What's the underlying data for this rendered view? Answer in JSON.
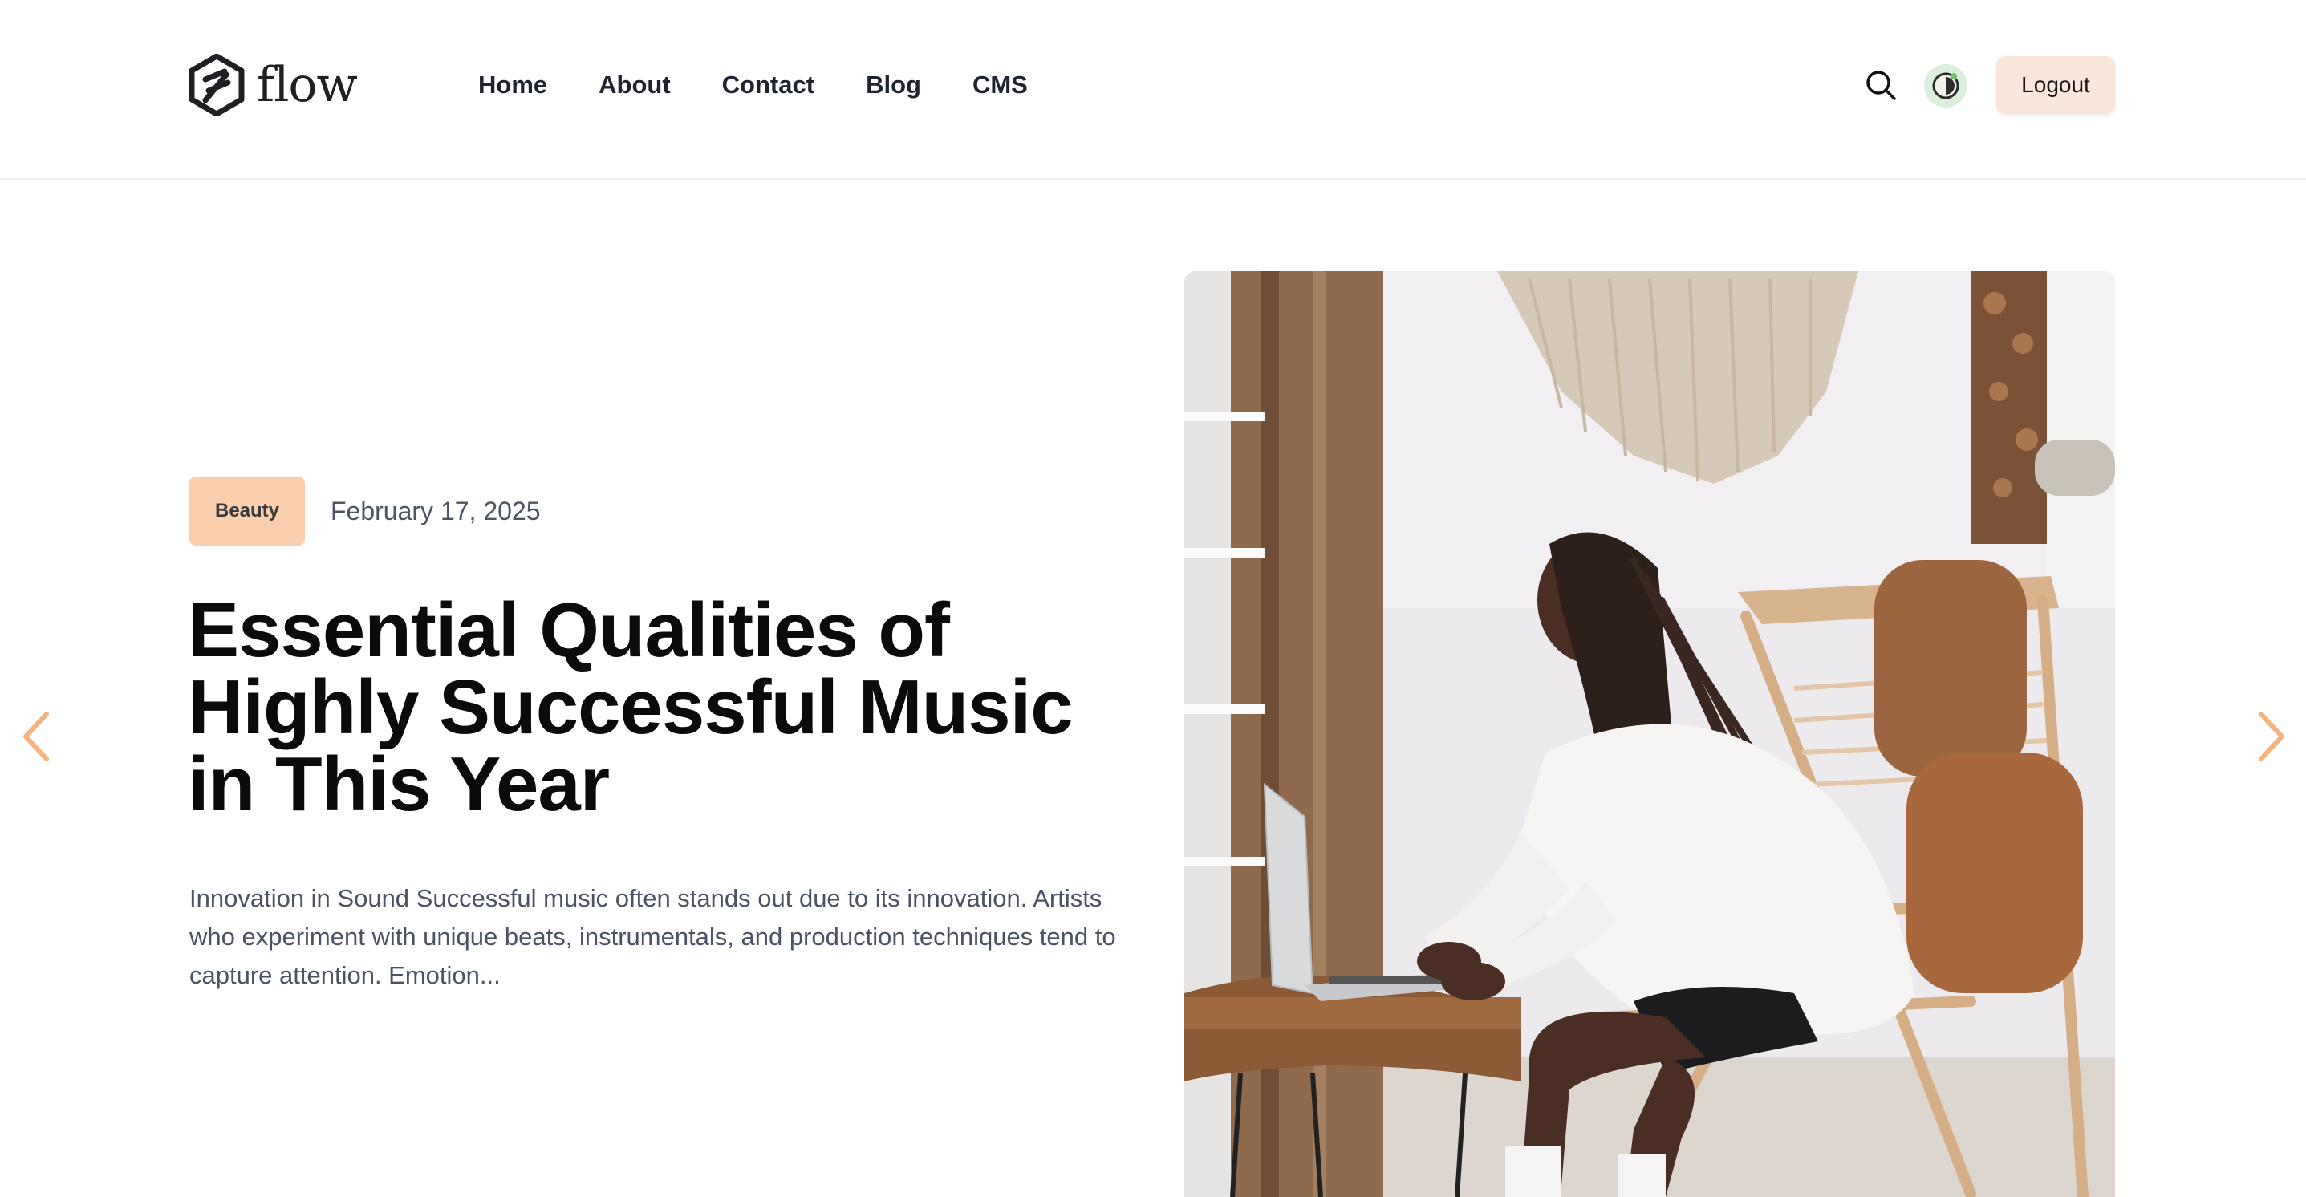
{
  "brand": {
    "name": "flow"
  },
  "nav": {
    "items": [
      {
        "label": "Home"
      },
      {
        "label": "About"
      },
      {
        "label": "Contact"
      },
      {
        "label": "Blog"
      },
      {
        "label": "CMS"
      }
    ]
  },
  "header_actions": {
    "search_icon": "search-icon",
    "theme_icon": "theme-toggle-icon",
    "logout_label": "Logout"
  },
  "featured_post": {
    "category": "Beauty",
    "date": "February 17, 2025",
    "title": "Essential Qualities of Highly Successful Music in This Year",
    "excerpt": "Innovation in Sound Successful music often stands out due to its innovation. Artists who experiment with unique beats, instrumentals, and production techniques tend to capture attention. Emotion...",
    "image_icon": "woman-working-on-laptop-photo"
  },
  "slider": {
    "prev_icon": "chevron-left-icon",
    "next_icon": "chevron-right-icon"
  },
  "colors": {
    "accent": "#f7b98a",
    "badge_bg": "#f9cfae",
    "logout_bg": "#fbe6dc",
    "theme_bg": "#dcefdc",
    "arrow": "#f4b37f",
    "title": "#0b0b0b",
    "body_text": "#4a5364"
  }
}
